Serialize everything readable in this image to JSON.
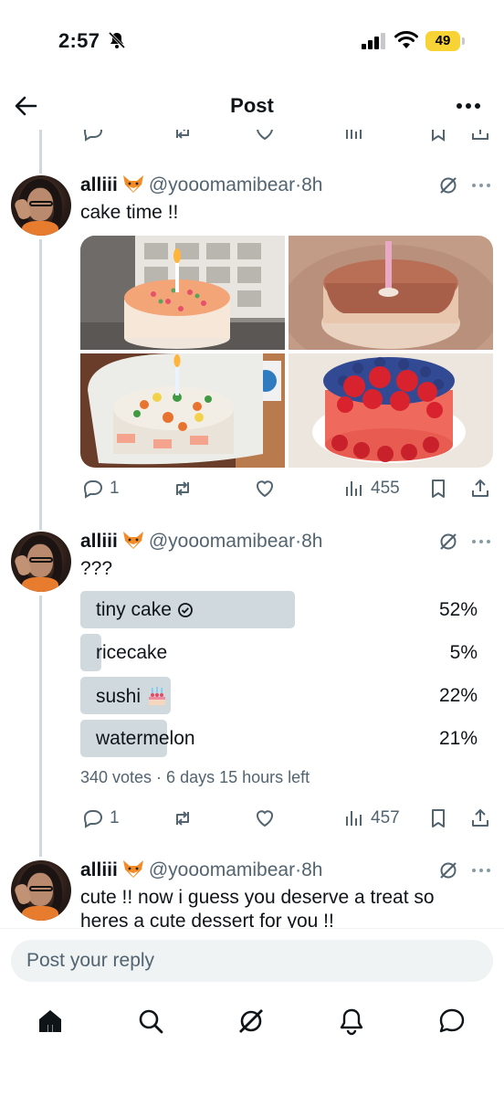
{
  "status_bar": {
    "time": "2:57",
    "battery": "49"
  },
  "header": {
    "title": "Post"
  },
  "colors": {
    "accent": "#1d9bf0",
    "muted": "#536471",
    "poll_bar": "#cfd9de",
    "battery": "#f7d336"
  },
  "tweets": [
    {
      "name": "alliii",
      "handle": "@yooomamibear",
      "sep": "·",
      "time": "8h",
      "text": "cake time !!",
      "media": [
        "cake-with-sprinkles",
        "chocolate-cake-with-candle",
        "sushi-cake",
        "watermelon-cake-with-berries"
      ],
      "stats": {
        "replies": "1",
        "views": "455"
      }
    },
    {
      "name": "alliii",
      "handle": "@yooomamibear",
      "sep": "·",
      "time": "8h",
      "text": "???",
      "poll": {
        "options": [
          {
            "label": "tiny cake",
            "percent": "52%",
            "value": 52,
            "winner": true
          },
          {
            "label": "ricecake",
            "percent": "5%",
            "value": 5,
            "winner": false
          },
          {
            "label": "sushi",
            "percent": "22%",
            "value": 22,
            "winner": false
          },
          {
            "label": "watermelon",
            "percent": "21%",
            "value": 21,
            "winner": false
          }
        ],
        "summary": "340 votes · 6 days 15 hours left"
      },
      "stats": {
        "replies": "1",
        "views": "457"
      }
    },
    {
      "name": "alliii",
      "handle": "@yooomamibear",
      "sep": "·",
      "time": "8h",
      "text": "cute !! now i guess you deserve a treat so heres a cute dessert for you !!"
    }
  ],
  "reply": {
    "placeholder": "Post your reply"
  },
  "tabs": [
    "home-icon",
    "search-icon",
    "grok-icon",
    "notifications-icon",
    "messages-icon"
  ]
}
